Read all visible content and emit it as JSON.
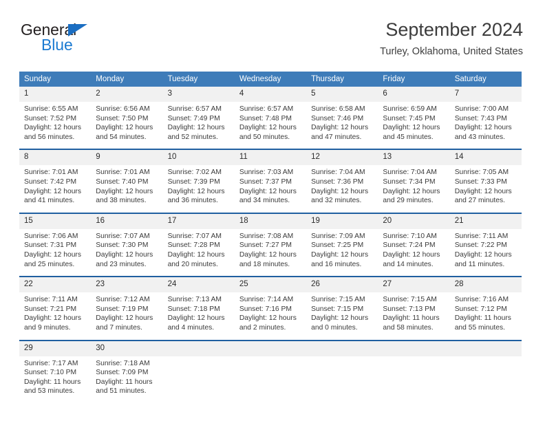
{
  "brand": {
    "name_part1": "General",
    "name_part2": "Blue",
    "triangle_color": "#1b6ec2",
    "blue_color": "#1b7ad1",
    "dark_color": "#231f20"
  },
  "header": {
    "title": "September 2024",
    "subtitle": "Turley, Oklahoma, United States"
  },
  "theme": {
    "header_bg": "#3e7cb9",
    "week_divider": "#1f5fa0",
    "daynum_bg": "#f1f1f1",
    "text": "#3a3a3a"
  },
  "calendar": {
    "weekdays": [
      "Sunday",
      "Monday",
      "Tuesday",
      "Wednesday",
      "Thursday",
      "Friday",
      "Saturday"
    ],
    "weeks": [
      [
        {
          "day": "1",
          "sunrise": "Sunrise: 6:55 AM",
          "sunset": "Sunset: 7:52 PM",
          "daylight1": "Daylight: 12 hours",
          "daylight2": "and 56 minutes."
        },
        {
          "day": "2",
          "sunrise": "Sunrise: 6:56 AM",
          "sunset": "Sunset: 7:50 PM",
          "daylight1": "Daylight: 12 hours",
          "daylight2": "and 54 minutes."
        },
        {
          "day": "3",
          "sunrise": "Sunrise: 6:57 AM",
          "sunset": "Sunset: 7:49 PM",
          "daylight1": "Daylight: 12 hours",
          "daylight2": "and 52 minutes."
        },
        {
          "day": "4",
          "sunrise": "Sunrise: 6:57 AM",
          "sunset": "Sunset: 7:48 PM",
          "daylight1": "Daylight: 12 hours",
          "daylight2": "and 50 minutes."
        },
        {
          "day": "5",
          "sunrise": "Sunrise: 6:58 AM",
          "sunset": "Sunset: 7:46 PM",
          "daylight1": "Daylight: 12 hours",
          "daylight2": "and 47 minutes."
        },
        {
          "day": "6",
          "sunrise": "Sunrise: 6:59 AM",
          "sunset": "Sunset: 7:45 PM",
          "daylight1": "Daylight: 12 hours",
          "daylight2": "and 45 minutes."
        },
        {
          "day": "7",
          "sunrise": "Sunrise: 7:00 AM",
          "sunset": "Sunset: 7:43 PM",
          "daylight1": "Daylight: 12 hours",
          "daylight2": "and 43 minutes."
        }
      ],
      [
        {
          "day": "8",
          "sunrise": "Sunrise: 7:01 AM",
          "sunset": "Sunset: 7:42 PM",
          "daylight1": "Daylight: 12 hours",
          "daylight2": "and 41 minutes."
        },
        {
          "day": "9",
          "sunrise": "Sunrise: 7:01 AM",
          "sunset": "Sunset: 7:40 PM",
          "daylight1": "Daylight: 12 hours",
          "daylight2": "and 38 minutes."
        },
        {
          "day": "10",
          "sunrise": "Sunrise: 7:02 AM",
          "sunset": "Sunset: 7:39 PM",
          "daylight1": "Daylight: 12 hours",
          "daylight2": "and 36 minutes."
        },
        {
          "day": "11",
          "sunrise": "Sunrise: 7:03 AM",
          "sunset": "Sunset: 7:37 PM",
          "daylight1": "Daylight: 12 hours",
          "daylight2": "and 34 minutes."
        },
        {
          "day": "12",
          "sunrise": "Sunrise: 7:04 AM",
          "sunset": "Sunset: 7:36 PM",
          "daylight1": "Daylight: 12 hours",
          "daylight2": "and 32 minutes."
        },
        {
          "day": "13",
          "sunrise": "Sunrise: 7:04 AM",
          "sunset": "Sunset: 7:34 PM",
          "daylight1": "Daylight: 12 hours",
          "daylight2": "and 29 minutes."
        },
        {
          "day": "14",
          "sunrise": "Sunrise: 7:05 AM",
          "sunset": "Sunset: 7:33 PM",
          "daylight1": "Daylight: 12 hours",
          "daylight2": "and 27 minutes."
        }
      ],
      [
        {
          "day": "15",
          "sunrise": "Sunrise: 7:06 AM",
          "sunset": "Sunset: 7:31 PM",
          "daylight1": "Daylight: 12 hours",
          "daylight2": "and 25 minutes."
        },
        {
          "day": "16",
          "sunrise": "Sunrise: 7:07 AM",
          "sunset": "Sunset: 7:30 PM",
          "daylight1": "Daylight: 12 hours",
          "daylight2": "and 23 minutes."
        },
        {
          "day": "17",
          "sunrise": "Sunrise: 7:07 AM",
          "sunset": "Sunset: 7:28 PM",
          "daylight1": "Daylight: 12 hours",
          "daylight2": "and 20 minutes."
        },
        {
          "day": "18",
          "sunrise": "Sunrise: 7:08 AM",
          "sunset": "Sunset: 7:27 PM",
          "daylight1": "Daylight: 12 hours",
          "daylight2": "and 18 minutes."
        },
        {
          "day": "19",
          "sunrise": "Sunrise: 7:09 AM",
          "sunset": "Sunset: 7:25 PM",
          "daylight1": "Daylight: 12 hours",
          "daylight2": "and 16 minutes."
        },
        {
          "day": "20",
          "sunrise": "Sunrise: 7:10 AM",
          "sunset": "Sunset: 7:24 PM",
          "daylight1": "Daylight: 12 hours",
          "daylight2": "and 14 minutes."
        },
        {
          "day": "21",
          "sunrise": "Sunrise: 7:11 AM",
          "sunset": "Sunset: 7:22 PM",
          "daylight1": "Daylight: 12 hours",
          "daylight2": "and 11 minutes."
        }
      ],
      [
        {
          "day": "22",
          "sunrise": "Sunrise: 7:11 AM",
          "sunset": "Sunset: 7:21 PM",
          "daylight1": "Daylight: 12 hours",
          "daylight2": "and 9 minutes."
        },
        {
          "day": "23",
          "sunrise": "Sunrise: 7:12 AM",
          "sunset": "Sunset: 7:19 PM",
          "daylight1": "Daylight: 12 hours",
          "daylight2": "and 7 minutes."
        },
        {
          "day": "24",
          "sunrise": "Sunrise: 7:13 AM",
          "sunset": "Sunset: 7:18 PM",
          "daylight1": "Daylight: 12 hours",
          "daylight2": "and 4 minutes."
        },
        {
          "day": "25",
          "sunrise": "Sunrise: 7:14 AM",
          "sunset": "Sunset: 7:16 PM",
          "daylight1": "Daylight: 12 hours",
          "daylight2": "and 2 minutes."
        },
        {
          "day": "26",
          "sunrise": "Sunrise: 7:15 AM",
          "sunset": "Sunset: 7:15 PM",
          "daylight1": "Daylight: 12 hours",
          "daylight2": "and 0 minutes."
        },
        {
          "day": "27",
          "sunrise": "Sunrise: 7:15 AM",
          "sunset": "Sunset: 7:13 PM",
          "daylight1": "Daylight: 11 hours",
          "daylight2": "and 58 minutes."
        },
        {
          "day": "28",
          "sunrise": "Sunrise: 7:16 AM",
          "sunset": "Sunset: 7:12 PM",
          "daylight1": "Daylight: 11 hours",
          "daylight2": "and 55 minutes."
        }
      ],
      [
        {
          "day": "29",
          "sunrise": "Sunrise: 7:17 AM",
          "sunset": "Sunset: 7:10 PM",
          "daylight1": "Daylight: 11 hours",
          "daylight2": "and 53 minutes."
        },
        {
          "day": "30",
          "sunrise": "Sunrise: 7:18 AM",
          "sunset": "Sunset: 7:09 PM",
          "daylight1": "Daylight: 11 hours",
          "daylight2": "and 51 minutes."
        },
        {
          "day": "",
          "sunrise": "",
          "sunset": "",
          "daylight1": "",
          "daylight2": ""
        },
        {
          "day": "",
          "sunrise": "",
          "sunset": "",
          "daylight1": "",
          "daylight2": ""
        },
        {
          "day": "",
          "sunrise": "",
          "sunset": "",
          "daylight1": "",
          "daylight2": ""
        },
        {
          "day": "",
          "sunrise": "",
          "sunset": "",
          "daylight1": "",
          "daylight2": ""
        },
        {
          "day": "",
          "sunrise": "",
          "sunset": "",
          "daylight1": "",
          "daylight2": ""
        }
      ]
    ]
  }
}
